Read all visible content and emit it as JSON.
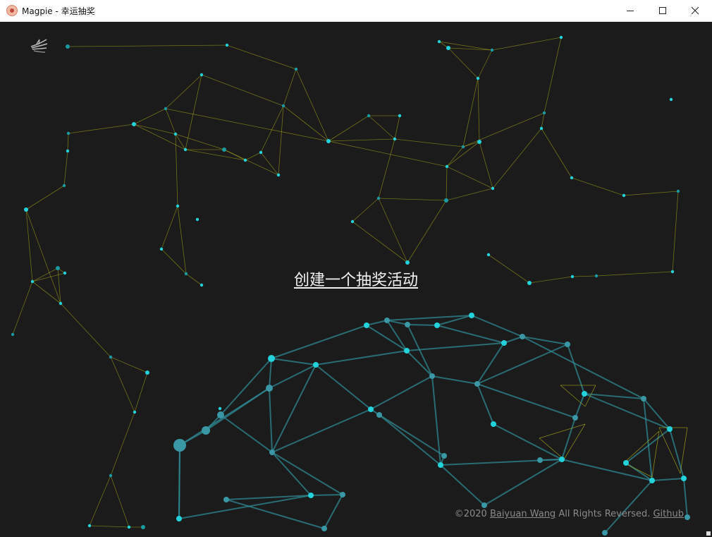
{
  "window": {
    "title": "Magpie - 幸运抽奖",
    "app_icon": "magpie-app-icon",
    "controls": {
      "minimize": "minimize-icon",
      "maximize": "maximize-icon",
      "close": "close-icon"
    }
  },
  "main": {
    "logo": "magpie-logo-icon",
    "cta_label": "创建一个抽奖活动",
    "background": "particle-network"
  },
  "footer": {
    "prefix": "©2020 ",
    "author": "Baiyuan Wang",
    "middle": " All Rights Reversed. ",
    "github": "Github"
  },
  "colors": {
    "background": "#1b1b1b",
    "node": "#22d3dc",
    "node_dim": "#1a9aa3",
    "line_yellow": "#b8b81a",
    "sphere_line": "#2f8e9a",
    "cta_text": "#f2f2f2",
    "footer_text": "#8a8a8a"
  }
}
